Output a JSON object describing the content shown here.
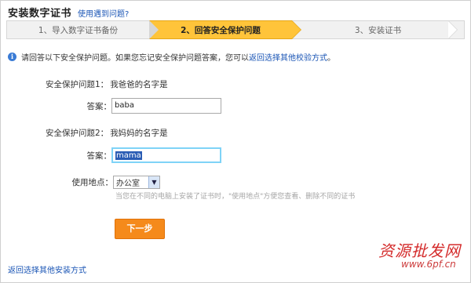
{
  "header": {
    "title": "安装数字证书",
    "help_link": "使用遇到问题?"
  },
  "steps": [
    {
      "label": "1、导入数字证书备份"
    },
    {
      "label": "2、回答安全保护问题"
    },
    {
      "label": "3、安装证书"
    }
  ],
  "notice": {
    "text": "请回答以下安全保护问题。如果您忘记安全保护问题答案，您可以",
    "link": "返回选择其他校验方式",
    "end": "。"
  },
  "form": {
    "q1_label": "安全保护问题1：",
    "q1_value": "我爸爸的名字是",
    "a1_label": "答案：",
    "a1_value": "baba",
    "q2_label": "安全保护问题2：",
    "q2_value": "我妈妈的名字是",
    "a2_label": "答案：",
    "a2_value": "mama",
    "location_label": "使用地点：",
    "location_value": "办公室",
    "hint": "当您在不同的电脑上安装了证书时，\"使用地点\"方便您查看、删除不同的证书",
    "next_label": "下一步"
  },
  "footer": {
    "link": "返回选择其他安装方式"
  },
  "watermark": {
    "cn": "资源批发网",
    "url": "www.6pf.cn"
  },
  "colors": {
    "active_step": "#ffc43a",
    "button": "#f58a1b",
    "link": "#1a55b5"
  }
}
